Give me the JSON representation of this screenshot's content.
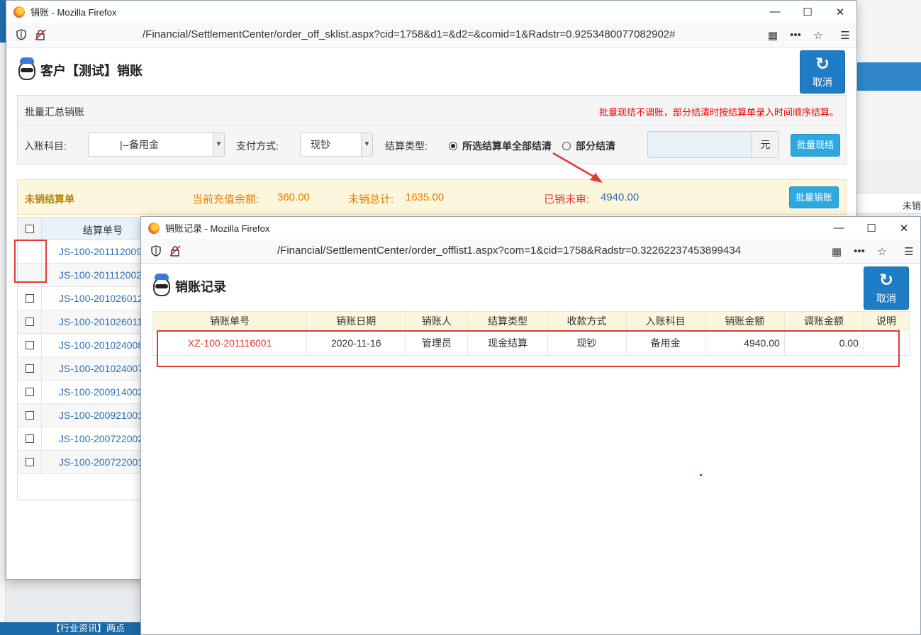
{
  "main_window": {
    "title": "销账 - Mozilla Firefox",
    "url": "/Financial/SettlementCenter/order_off_sklist.aspx?cid=1758&d1=&d2=&comid=1&Radstr=0.9253480077082902#",
    "page_title": "客户【测试】销账",
    "cancel_label": "取消",
    "batch_panel": {
      "heading": "批量汇总销账",
      "notice": "批量现结不调账，部分结清时按结算单录入时间顺序结算。",
      "account_label": "入账科目:",
      "account_value": "|--备用金",
      "payment_label": "支付方式:",
      "payment_value": "现钞",
      "settle_type_label": "结算类型:",
      "radio_all": "所选结算单全部结清",
      "radio_partial": "部分结清",
      "amount_unit": "元",
      "batch_cash_button": "批量现结"
    },
    "summary_bar": {
      "label": "未销结算单",
      "balance_label": "当前充值余额:",
      "balance_value": "360.00",
      "unsettled_label": "未销总计:",
      "unsettled_value": "1635.00",
      "settled_unreviewed_label": "已销未审:",
      "settled_unreviewed_value": "4940.00",
      "batch_writeoff_button": "批量销账"
    },
    "table": {
      "header_number": "结算单号",
      "rows": [
        "JS-100-201112009",
        "JS-100-201112002",
        "JS-100-201026012",
        "JS-100-201026011",
        "JS-100-201024008",
        "JS-100-201024007",
        "JS-100-200914002",
        "JS-100-200921001",
        "JS-100-200722002",
        "JS-100-200722001"
      ]
    }
  },
  "popup_window": {
    "title": "销账记录 - Mozilla Firefox",
    "url": "/Financial/SettlementCenter/order_offlist1.aspx?com=1&cid=1758&Radstr=0.32262237453899434",
    "page_title": "销账记录",
    "cancel_label": "取消",
    "columns": [
      "销账单号",
      "销账日期",
      "销账人",
      "结算类型",
      "收款方式",
      "入账科目",
      "销账金额",
      "调账金额",
      "说明"
    ],
    "rows": [
      {
        "number": "XZ-100-201116001",
        "date": "2020-11-16",
        "user": "管理员",
        "settle_type": "现金结算",
        "payment": "现钞",
        "account": "备用金",
        "amount": "4940.00",
        "adjust": "0.00",
        "note": ""
      }
    ]
  },
  "background": {
    "right_column_header": "未销",
    "bottom_ticker": "【行业资讯】两点"
  },
  "colors": {
    "primary_blue": "#1f7dc8",
    "button_blue": "#2ea8e0",
    "accent_orange": "#e67e00",
    "alert_red": "#e53935",
    "link_blue": "#2c6fb6"
  }
}
